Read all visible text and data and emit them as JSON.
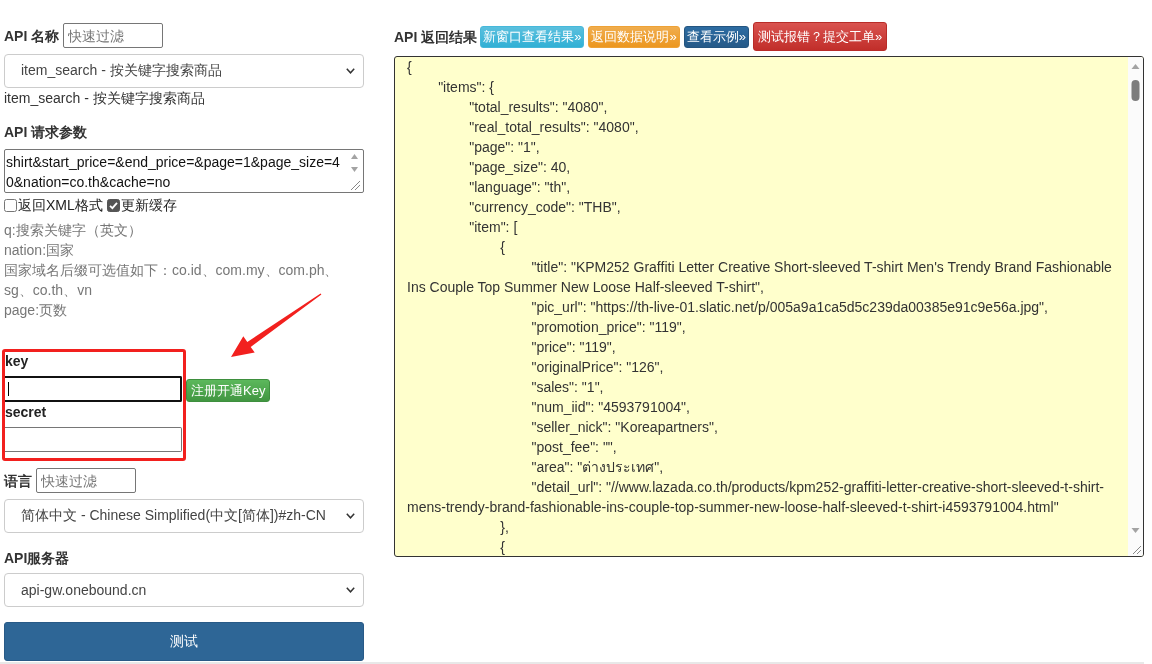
{
  "api_name": {
    "label": "API 名称",
    "filter": {
      "placeholder": "快速过滤"
    },
    "select": {
      "value": "item_search - 按关键字搜索商品"
    },
    "description": "item_search - 按关键字搜索商品"
  },
  "request_params": {
    "label": "API 请求参数",
    "value": "shirt&start_price=&end_price=&page=1&page_size=40&nation=co.th&cache=no",
    "options": [
      {
        "label": "返回XML格式",
        "checked": false
      },
      {
        "label": "更新缓存",
        "checked": true
      }
    ],
    "help": [
      "q:搜索关键字（英文）",
      "nation:国家",
      "国家域名后缀可选值如下：co.id、com.my、com.ph、sg、co.th、vn",
      "page:页数"
    ]
  },
  "credentials": [
    {
      "label": "key",
      "focused": true,
      "button": "注册开通Key"
    },
    {
      "label": "secret",
      "focused": false
    }
  ],
  "language": {
    "label": "语言",
    "filter": {
      "placeholder": "快速过滤"
    },
    "select": {
      "value": "简体中文 - Chinese Simplified(中文[简体])#zh-CN"
    }
  },
  "server": {
    "label": "API服务器",
    "select": {
      "value": "api-gw.onebound.cn"
    }
  },
  "test_button": "测试",
  "result": {
    "label": "API 返回结果",
    "buttons": [
      {
        "label": "新窗口查看结果»",
        "kind": "info"
      },
      {
        "label": "返回数据说明»",
        "kind": "warning"
      },
      {
        "label": "查看示例»",
        "kind": "primary"
      },
      {
        "label": "测试报错？提交工单»",
        "kind": "danger"
      }
    ],
    "lines": [
      "{",
      "\t\"items\": {",
      "\t\t\"total_results\": \"4080\",",
      "\t\t\"real_total_results\": \"4080\",",
      "\t\t\"page\": \"1\",",
      "\t\t\"page_size\": 40,",
      "\t\t\"language\": \"th\",",
      "\t\t\"currency_code\": \"THB\",",
      "\t\t\"item\": [",
      "\t\t\t{",
      "\t\t\t\t\"title\": \"KPM252 Graffiti Letter Creative Short-sleeved T-shirt Men's Trendy Brand Fashionable Ins Couple Top Summer New Loose Half-sleeved T-shirt\",",
      "\t\t\t\t\"pic_url\": \"https://th-live-01.slatic.net/p/005a9a1ca5d5c239da00385e91c9e56a.jpg\",",
      "\t\t\t\t\"promotion_price\": \"119\",",
      "\t\t\t\t\"price\": \"119\",",
      "\t\t\t\t\"originalPrice\": \"126\",",
      "\t\t\t\t\"sales\": \"1\",",
      "\t\t\t\t\"num_iid\": \"4593791004\",",
      "\t\t\t\t\"seller_nick\": \"Koreapartners\",",
      "\t\t\t\t\"post_fee\": \"\",",
      "\t\t\t\t\"area\": \"ต่างประเทศ\",",
      "\t\t\t\t\"detail_url\": \"//www.lazada.co.th/products/kpm252-graffiti-letter-creative-short-sleeved-t-shirt-mens-trendy-brand-fashionable-ins-couple-top-summer-new-loose-half-sleeved-t-shirt-i4593791004.html\"",
      "\t\t\t},",
      "\t\t\t{"
    ]
  },
  "annotations": {
    "frame": true,
    "arrow": true
  }
}
